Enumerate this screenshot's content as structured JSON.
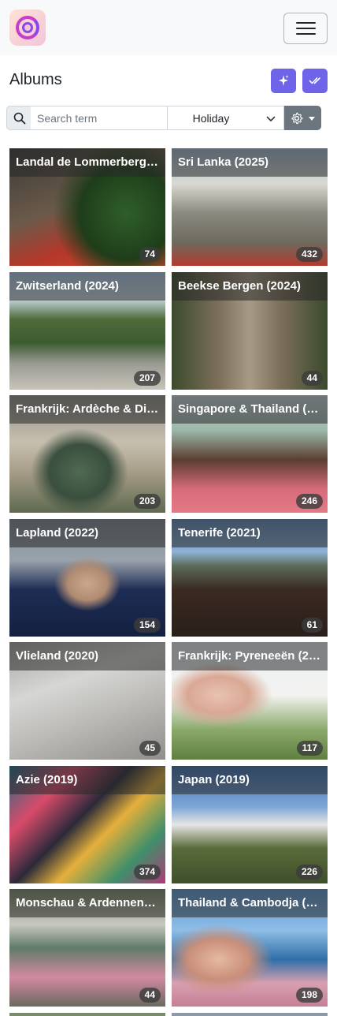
{
  "header": {
    "logo": "app-logo",
    "menu_icon": "hamburger-icon"
  },
  "toolbar": {
    "title": "Albums",
    "actions": [
      {
        "name": "magic-sparkles-button",
        "icon": "sparkles-icon"
      },
      {
        "name": "select-all-button",
        "icon": "double-check-icon"
      }
    ]
  },
  "search": {
    "placeholder": "Search term",
    "value": "",
    "filter_selected": "Holiday",
    "settings_icon": "gear-icon"
  },
  "albums": [
    {
      "title": "Landal de Lommerberg…",
      "count": "74"
    },
    {
      "title": "Sri Lanka (2025)",
      "count": "432"
    },
    {
      "title": "Zwitserland (2024)",
      "count": "207"
    },
    {
      "title": "Beekse Bergen (2024)",
      "count": "44"
    },
    {
      "title": "Frankrijk: Ardèche & Di…",
      "count": "203"
    },
    {
      "title": "Singapore & Thailand (…",
      "count": "246"
    },
    {
      "title": "Lapland (2022)",
      "count": "154"
    },
    {
      "title": "Tenerife (2021)",
      "count": "61"
    },
    {
      "title": "Vlieland (2020)",
      "count": "45"
    },
    {
      "title": "Frankrijk: Pyreneeën (2…",
      "count": "117"
    },
    {
      "title": "Azie (2019)",
      "count": "374"
    },
    {
      "title": "Japan (2019)",
      "count": "226"
    },
    {
      "title": "Monschau & Ardennen…",
      "count": "44"
    },
    {
      "title": "Thailand & Cambodja (…",
      "count": "198"
    }
  ],
  "colors": {
    "accent": "#6f63ea",
    "secondary": "#6c757d",
    "navbar_bg": "#f8f9fa"
  }
}
